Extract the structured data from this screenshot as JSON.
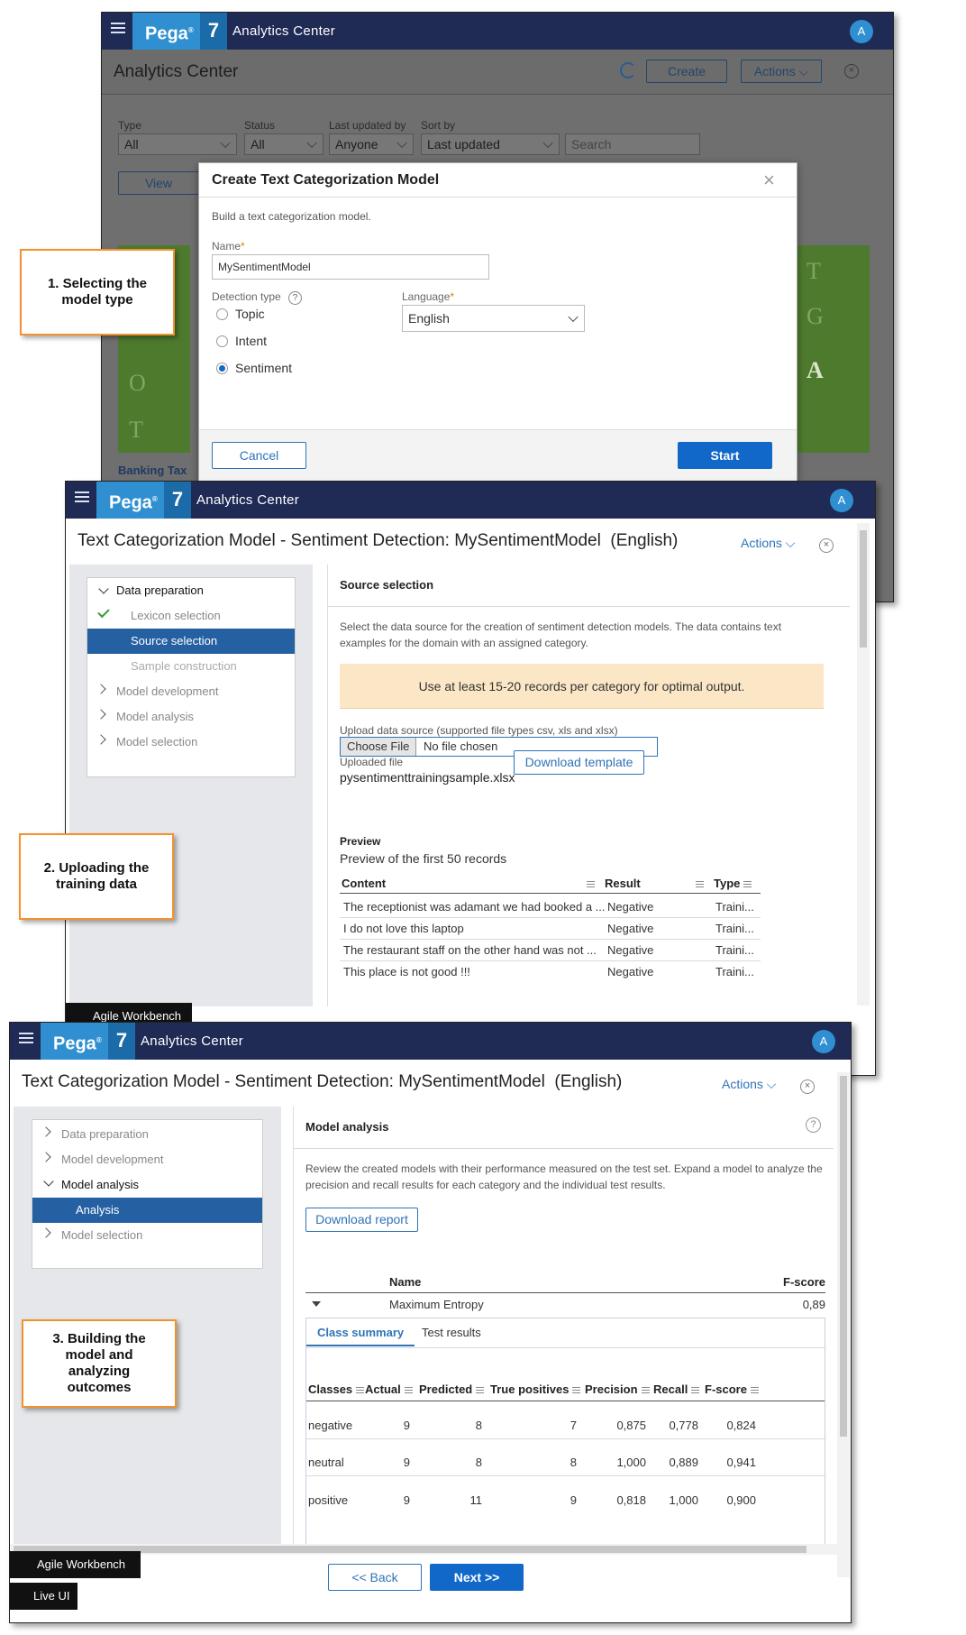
{
  "shot1": {
    "app_name": "Analytics Center",
    "avatar": "A",
    "page_title": "Analytics Center",
    "create_label": "Create",
    "actions_label": "Actions",
    "filters": {
      "type_label": "Type",
      "type_value": "All",
      "status_label": "Status",
      "status_value": "All",
      "updated_by_label": "Last updated by",
      "updated_by_value": "Anyone",
      "sort_label": "Sort by",
      "sort_value": "Last updated",
      "search_placeholder": "Search"
    },
    "view_label": "View",
    "card_letters_left": [
      "O",
      "T"
    ],
    "card_letters_right": [
      "T",
      "G",
      "A"
    ],
    "card_title": "Banking Tax"
  },
  "modal": {
    "title": "Create Text Categorization Model",
    "description": "Build a text categorization model.",
    "name_label": "Name",
    "name_value": "MySentimentModel",
    "detection_label": "Detection type",
    "options": [
      "Topic",
      "Intent",
      "Sentiment"
    ],
    "selected_option": "Sentiment",
    "language_label": "Language",
    "language_value": "English",
    "cancel_label": "Cancel",
    "start_label": "Start"
  },
  "shot2": {
    "app_name": "Analytics Center",
    "avatar": "A",
    "page_title": "Text Categorization Model - Sentiment Detection: MySentimentModel  (English)",
    "actions_label": "Actions",
    "nav": {
      "data_prep": "Data preparation",
      "lexicon": "Lexicon selection",
      "source": "Source selection",
      "sample": "Sample construction",
      "model_dev": "Model development",
      "model_analysis": "Model analysis",
      "model_selection": "Model selection"
    },
    "section_title": "Source selection",
    "description": "Select the data source for the creation of sentiment detection models. The data contains text examples for the domain with an assigned category.",
    "banner": "Use at least 15-20 records per category for optimal output.",
    "upload_label": "Upload data source (supported file types csv, xls and xlsx)",
    "choose_file": "Choose File",
    "no_file": "No file chosen",
    "uploaded_label": "Uploaded file",
    "uploaded_file": "pysentimenttrainingsample.xlsx",
    "download_template": "Download template",
    "preview_title": "Preview",
    "preview_sub": "Preview of the first 50 records",
    "columns": [
      "Content",
      "Result",
      "Type"
    ],
    "rows": [
      [
        "The receptionist was adamant we had booked a ...",
        "Negative",
        "Traini..."
      ],
      [
        "I do not love this laptop",
        "Negative",
        "Traini..."
      ],
      [
        "The restaurant staff on the other hand was not ...",
        "Negative",
        "Traini..."
      ],
      [
        "This place is not good !!!",
        "Negative",
        "Traini..."
      ]
    ],
    "agile_workbench": "Agile Workbench"
  },
  "shot3": {
    "app_name": "Analytics Center",
    "avatar": "A",
    "page_title": "Text Categorization Model - Sentiment Detection: MySentimentModel  (English)",
    "actions_label": "Actions",
    "nav": {
      "data_prep": "Data preparation",
      "model_dev": "Model development",
      "model_analysis": "Model analysis",
      "analysis": "Analysis",
      "model_selection": "Model selection"
    },
    "section_title": "Model analysis",
    "description": "Review the created models with their performance measured on the test set. Expand a model to analyze the precision and recall results for each category and the individual test results.",
    "download_report": "Download report",
    "model_table": {
      "col_name": "Name",
      "col_fscore": "F-score",
      "model_name": "Maximum Entropy",
      "model_fscore": "0,89"
    },
    "tabs": [
      "Class summary",
      "Test results"
    ],
    "class_columns": [
      "Classes",
      "Actual",
      "Predicted",
      "True positives",
      "Precision",
      "Recall",
      "F-score"
    ],
    "class_rows": [
      [
        "negative",
        "9",
        "8",
        "7",
        "0,875",
        "0,778",
        "0,824"
      ],
      [
        "neutral",
        "9",
        "8",
        "8",
        "1,000",
        "0,889",
        "0,941"
      ],
      [
        "positive",
        "9",
        "11",
        "9",
        "0,818",
        "1,000",
        "0,900"
      ]
    ],
    "back_label": "<< Back",
    "next_label": "Next >>",
    "agile_workbench": "Agile Workbench",
    "live_ui": "Live UI"
  },
  "callouts": {
    "c1": "1. Selecting the model type",
    "c2": "2. Uploading the training data",
    "c3": "3. Building the model and analyzing outcomes"
  },
  "brand": {
    "product": "Pega",
    "version": "7"
  },
  "colors": {
    "header": "#1f2a55",
    "brand_blue": "#2f8fd0",
    "primary": "#1268c8",
    "nav_active": "#2560a2",
    "banner": "#fbe7c6",
    "callout_border": "#f2922e"
  }
}
